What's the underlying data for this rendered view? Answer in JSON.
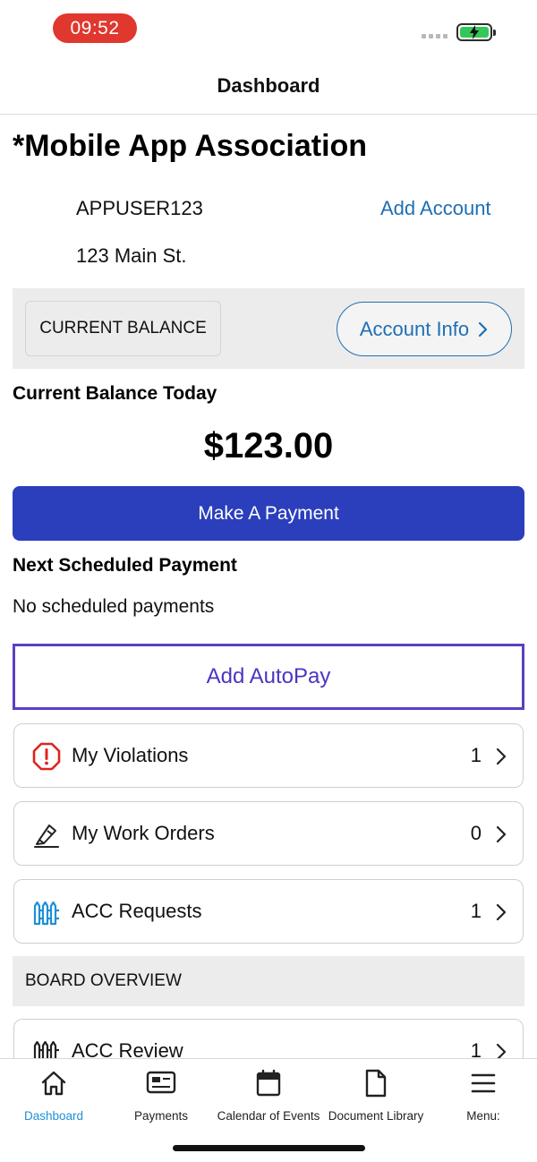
{
  "status_bar": {
    "time": "09:52"
  },
  "header": {
    "title": "Dashboard"
  },
  "association": {
    "name": "*Mobile App Association",
    "account_id": "APPUSER123",
    "address": "123 Main St.",
    "add_account_label": "Add Account"
  },
  "balance": {
    "tag_label": "CURRENT BALANCE",
    "account_info_label": "Account Info",
    "heading": "Current Balance Today",
    "amount": "$123.00",
    "pay_button_label": "Make A Payment"
  },
  "scheduled": {
    "heading": "Next Scheduled Payment",
    "status": "No scheduled payments",
    "autopay_label": "Add AutoPay"
  },
  "items": [
    {
      "label": "My Violations",
      "count": "1",
      "icon": "alert-octagon-icon",
      "icon_color": "#e0241b"
    },
    {
      "label": "My Work Orders",
      "count": "0",
      "icon": "pen-tool-icon",
      "icon_color": "#222222"
    },
    {
      "label": "ACC Requests",
      "count": "1",
      "icon": "fence-icon",
      "icon_color": "#1f8fd6"
    }
  ],
  "board": {
    "heading": "BOARD OVERVIEW",
    "items": [
      {
        "label": "ACC Review",
        "count": "1",
        "icon": "fence-icon"
      }
    ]
  },
  "tab_bar": {
    "tabs": [
      {
        "label": "Dashboard",
        "icon": "home-icon",
        "active": true
      },
      {
        "label": "Payments",
        "icon": "payment-card-icon",
        "active": false
      },
      {
        "label": "Calendar of Events",
        "icon": "calendar-icon",
        "active": false
      },
      {
        "label": "Document Library",
        "icon": "document-icon",
        "active": false
      },
      {
        "label": "Menu:",
        "icon": "menu-icon",
        "active": false
      }
    ]
  },
  "colors": {
    "primary_button": "#2b3fbd",
    "link": "#1f6fb5",
    "autopay_border": "#5b3fc4",
    "active_tab": "#1f8fd6",
    "status_time_pill": "#e0372e"
  }
}
